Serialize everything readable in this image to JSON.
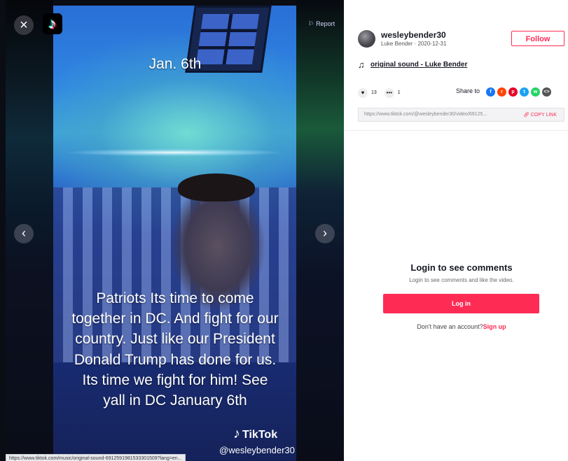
{
  "video": {
    "date_text": "Jan. 6th",
    "caption": "Patriots Its time to come together in DC. And fight for our country. Just like our President Donald Trump has done for us. Its time we fight for him! See yall in DC January 6th",
    "watermark_brand": "TikTok",
    "watermark_handle": "@wesleybender30"
  },
  "controls": {
    "close_icon": "×",
    "report_label": "Report",
    "prev_icon": "‹",
    "next_icon": "›"
  },
  "status_bar_url": "https://www.tiktok.com/music/original-sound-6912591981533301509?lang=en...",
  "post": {
    "username": "wesleybender30",
    "subline": "Luke Bender · 2020-12-31",
    "follow_label": "Follow",
    "sound_title": "original sound - Luke Bender",
    "likes": "13",
    "comments": "1",
    "share_label": "Share to",
    "share_icons": [
      "facebook-icon",
      "reddit-icon",
      "pinterest-icon",
      "twitter-icon",
      "whatsapp-icon",
      "embed-icon"
    ],
    "link_url": "https://www.tiktok.com/@wesleybender30/video/69125...",
    "copy_link_label": "COPY LINK"
  },
  "login": {
    "title": "Login to see comments",
    "subtitle": "Login to see comments and like the video.",
    "button_label": "Log in",
    "no_account_text": "Don't have an account?",
    "sign_up_label": "Sign up"
  },
  "colors": {
    "accent": "#fe2c55",
    "facebook": "#1877f2",
    "reddit": "#ff4500",
    "pinterest": "#e60023",
    "twitter": "#1da1f2",
    "whatsapp": "#25d366",
    "embed": "#555555"
  }
}
